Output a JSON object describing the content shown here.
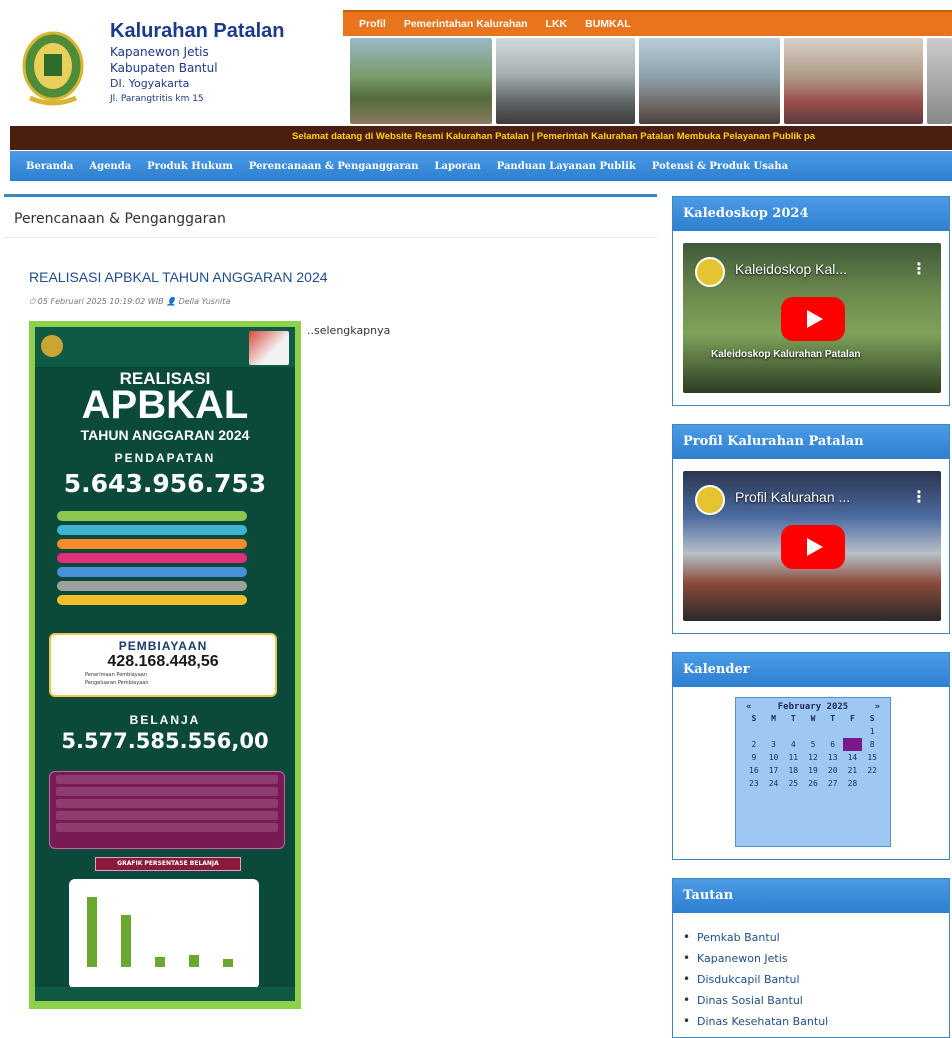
{
  "header": {
    "title": "Kalurahan Patalan",
    "line2": "Kapanewon Jetis",
    "line3": "Kabupaten Bantul",
    "line4": "DI. Yogyakarta",
    "address": "Jl. Parangtritis km 15"
  },
  "topmenu": [
    "Profil",
    "Pemerintahan Kalurahan",
    "LKK",
    "BUMKAL"
  ],
  "ticker": "Selamat datang di Website Resmi Kalurahan Patalan    |    Pemerintah Kalurahan Patalan Membuka Pelayanan Publik pa",
  "mainnav": [
    "Beranda",
    "Agenda",
    "Produk Hukum",
    "Perencanaan & Penganggaran",
    "Laporan",
    "Panduan Layanan Publik",
    "Potensi & Produk Usaha"
  ],
  "content": {
    "page_heading": "Perencanaan & Penganggaran",
    "post_title": "REALISASI APBKAL TAHUN ANGGARAN 2024",
    "post_meta": "⏱ 05 Februari 2025 10:19:02 WIB 👤 Della Yusnita",
    "readmore": "..selengkapnya",
    "poster": {
      "realisasi": "REALISASI",
      "apbkal": "APBKAL",
      "tahun": "TAHUN ANGGARAN 2024",
      "pendapatan_label": "PENDAPATAN",
      "pendapatan_value": "5.643.956.753",
      "pembiayaan_label": "PEMBIAYAAN",
      "pembiayaan_value": "428.168.448,56",
      "penerimaan_label": "Penerimaan Pembiayaan",
      "pengeluaran_label": "Pengeluaran Pembiayaan",
      "belanja_label": "BELANJA",
      "belanja_value": "5.577.585.556,00",
      "grafik_label": "GRAFIK PERSENTASE BELANJA",
      "bar_colors": [
        "#8cc850",
        "#41b4d2",
        "#f28c2c",
        "#e0307a",
        "#4a90d9",
        "#a0a0a0",
        "#f2c02c"
      ]
    }
  },
  "sidebar": {
    "kaleidoskop": {
      "title": "Kaledoskop 2024",
      "video_title": "Kaleidoskop Kal...",
      "caption": "Kaleidoskop Kalurahan Patalan"
    },
    "profil": {
      "title": "Profil Kalurahan Patalan",
      "video_title": "Profil Kalurahan ..."
    },
    "kalender": {
      "title": "Kalender",
      "prev": "«",
      "month": "February 2025",
      "next": "»",
      "dows": [
        "S",
        "M",
        "T",
        "W",
        "T",
        "F",
        "S"
      ],
      "days": [
        "",
        "",
        "",
        "",
        "",
        "",
        "1",
        "2",
        "3",
        "4",
        "5",
        "6",
        "7",
        "8",
        "9",
        "10",
        "11",
        "12",
        "13",
        "14",
        "15",
        "16",
        "17",
        "18",
        "19",
        "20",
        "21",
        "22",
        "23",
        "24",
        "25",
        "26",
        "27",
        "28",
        ""
      ],
      "today": "7"
    },
    "tautan": {
      "title": "Tautan",
      "items": [
        "Pemkab Bantul",
        "Kapanewon Jetis",
        "Disdukcapil Bantul",
        "Dinas Sosial Bantul",
        "Dinas Kesehatan Bantul"
      ]
    }
  }
}
